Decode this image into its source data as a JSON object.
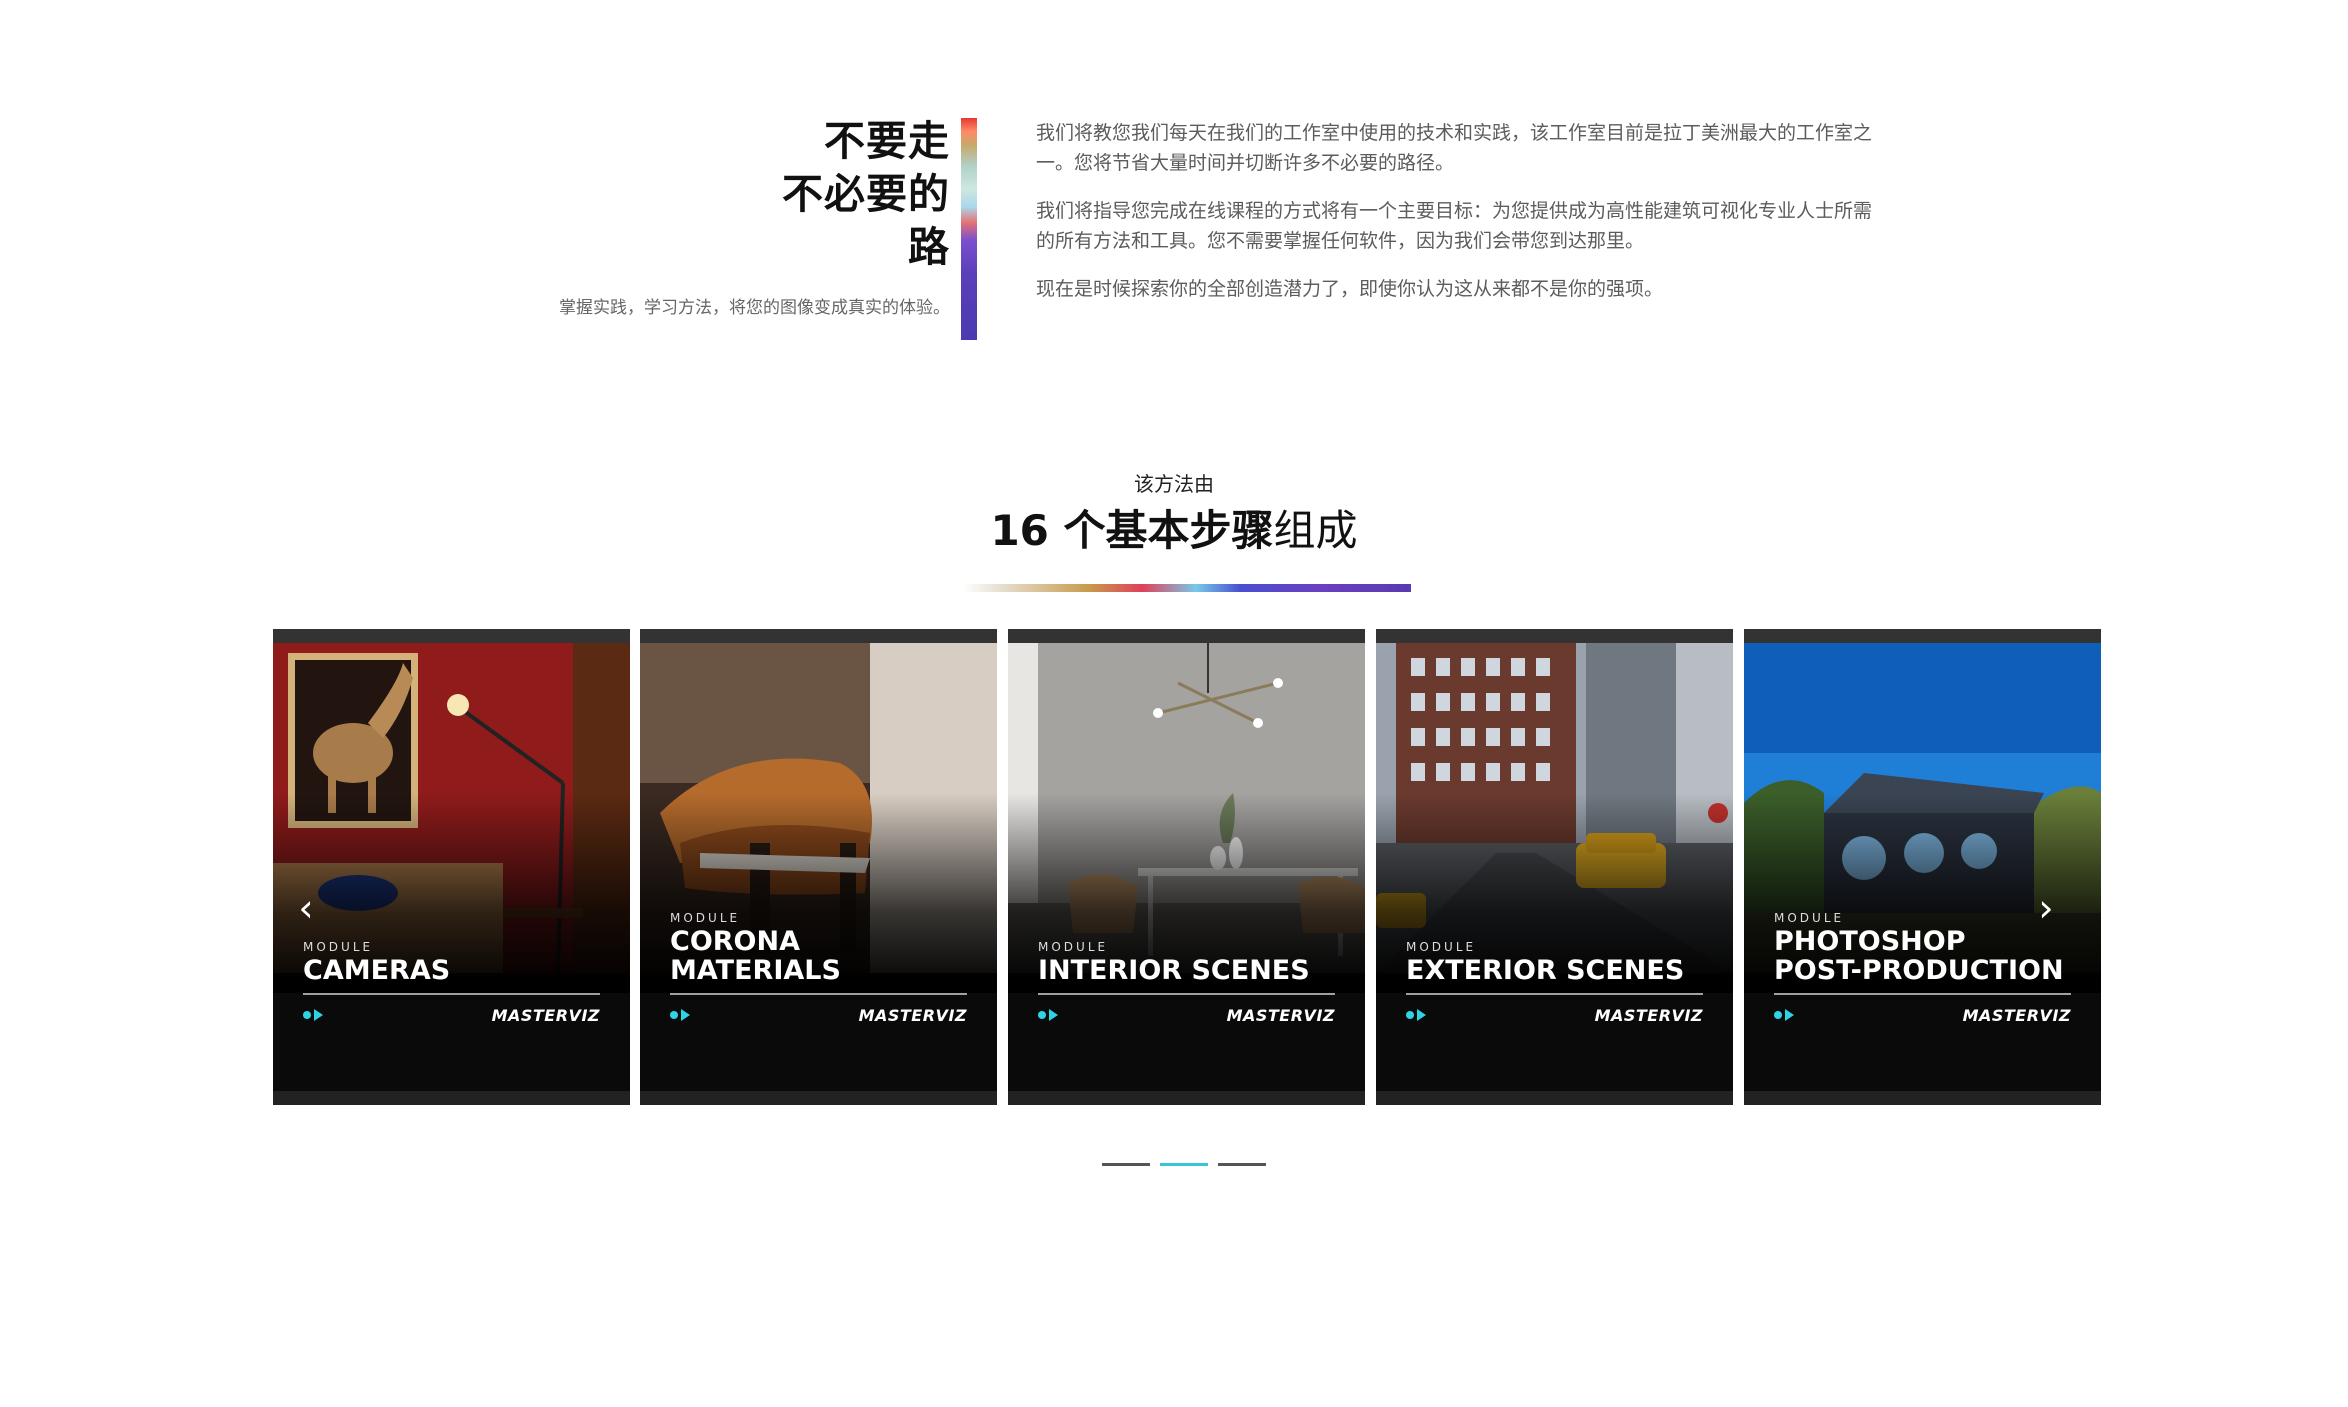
{
  "intro": {
    "title_lines": [
      "不要走",
      "不必要的",
      "路"
    ],
    "subtitle": "掌握实践，学习方法，将您的图像变成真实的体验。",
    "paragraphs": [
      "我们将教您我们每天在我们的工作室中使用的技术和实践，该工作室目前是拉丁美洲最大的工作室之一。您将节省大量时间并切断许多不必要的路径。",
      "我们将指导您完成在线课程的方式将有一个主要目标：为您提供成为高性能建筑可视化专业人士所需的所有方法和工具。您不需要掌握任何软件，因为我们会带您到达那里。",
      "现在是时候探索你的全部创造潜力了，即使你认为这从来都不是你的强项。"
    ]
  },
  "method": {
    "kicker": "该方法由",
    "heading_bold": "16 个基本步骤",
    "heading_light": "组成"
  },
  "carousel": {
    "prev_icon": "chevron-left-icon",
    "next_icon": "chevron-right-icon",
    "prev_glyph": "‹",
    "next_glyph": "›",
    "cards": [
      {
        "module": "MODULE",
        "title_lines": [
          "CAMERAS"
        ],
        "brand": "MASTERVIZ"
      },
      {
        "module": "MODULE",
        "title_lines": [
          "CORONA",
          "MATERIALS"
        ],
        "brand": "MASTERVIZ"
      },
      {
        "module": "MODULE",
        "title_lines": [
          "INTERIOR SCENES"
        ],
        "brand": "MASTERVIZ"
      },
      {
        "module": "MODULE",
        "title_lines": [
          "EXTERIOR SCENES"
        ],
        "brand": "MASTERVIZ"
      },
      {
        "module": "MODULE",
        "title_lines": [
          "PHOTOSHOP",
          "POST-PRODUCTION"
        ],
        "brand": "MASTERVIZ"
      }
    ],
    "accent_color": "#2ed3e6"
  },
  "pager": {
    "count": 3,
    "active_index": 1
  }
}
